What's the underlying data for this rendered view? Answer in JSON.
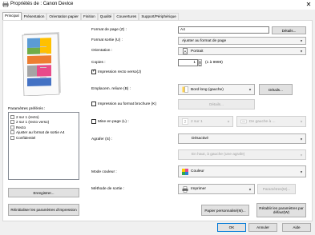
{
  "window": {
    "title": "Propriétés de : Canon Device",
    "close": "✕"
  },
  "tabs": [
    {
      "label": "Principal",
      "active": true
    },
    {
      "label": "Présentation"
    },
    {
      "label": "Orientation papier"
    },
    {
      "label": "Finition"
    },
    {
      "label": "Qualité"
    },
    {
      "label": "Couvertures"
    },
    {
      "label": "Support/Périphérique"
    }
  ],
  "favorites": {
    "label": "Paramètres préférés :",
    "items": [
      "2 sur 1 (recto)",
      "2 sur 1 (recto verso)",
      "Recto",
      "Ajuster au format de sortie A4",
      "Confidentiel"
    ],
    "save_button": "Enregistrer...",
    "reset_button": "Réinitialiser les paramètres d'impression"
  },
  "form": {
    "page_size_label": "Format de page (Z) :",
    "page_size_value": "A4",
    "details_button": "Détails...",
    "output_size_label": "Format sortie (U) :",
    "output_size_value": "Ajuster au format de page",
    "orientation_label": "Orientation :",
    "orientation_value": "Portrait",
    "copies_label": "Copies :",
    "copies_value": "1",
    "copies_range": "(1 à 9999)",
    "duplex_label": "Impression recto verso(J)",
    "binding_label": "Emplacem. reliure (B) :",
    "binding_value": "Bord long (gauche)",
    "binding_details": "Détails...",
    "booklet_label": "Impression au format brochure (K)",
    "booklet_details": "Détails...",
    "layout_label": "Mise en page (L) :",
    "layout_value": "2 sur 1",
    "layout_order_value": "De gauche à ...",
    "staple_label": "Agrafer (S) :",
    "staple_value": "Désactivé",
    "staple_position_value": "En haut, à gauche (une agrafe)",
    "color_mode_label": "Mode couleur :",
    "color_mode_value": "Couleur",
    "output_method_label": "Méthode de sortie :",
    "output_method_value": "Imprimer",
    "output_method_settings": "Paramètres(M)...",
    "custom_paper_button": "Papier personnalisé(M)...",
    "restore_defaults_button": "Rétablir les paramètres par défaut(W)"
  },
  "footer": {
    "ok": "OK",
    "cancel": "Annuler",
    "help": "Aide"
  }
}
